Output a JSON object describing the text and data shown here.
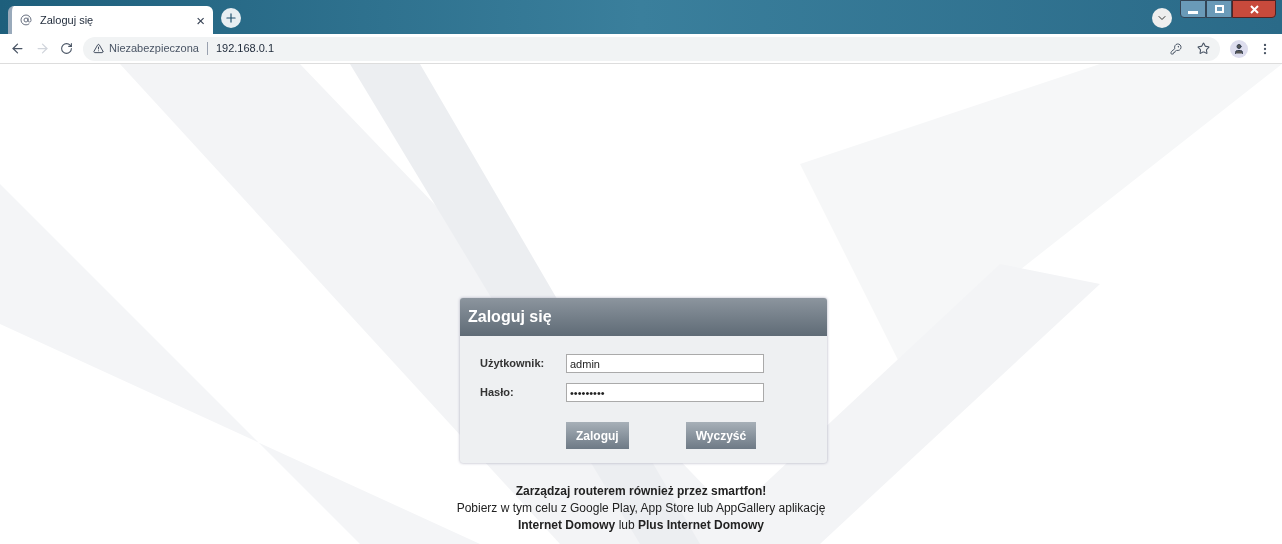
{
  "browser": {
    "tab": {
      "title": "Zaloguj się",
      "close": "×"
    },
    "address": {
      "security": "Niezabezpieczona",
      "url": "192.168.0.1"
    }
  },
  "login": {
    "title": "Zaloguj się",
    "fields": [
      {
        "label": "Użytkownik:",
        "value": "admin"
      },
      {
        "label": "Hasło:",
        "value": "•••••••••"
      }
    ],
    "buttons": [
      "Zaloguj",
      "Wyczyść"
    ]
  },
  "promo": {
    "heading": "Zarządzaj routerem również przez smartfon!",
    "line": "Pobierz w tym celu z Google Play, App Store lub AppGallery aplikację",
    "apps": "**Internet Domowy** lub **Plus Internet Domowy**"
  }
}
